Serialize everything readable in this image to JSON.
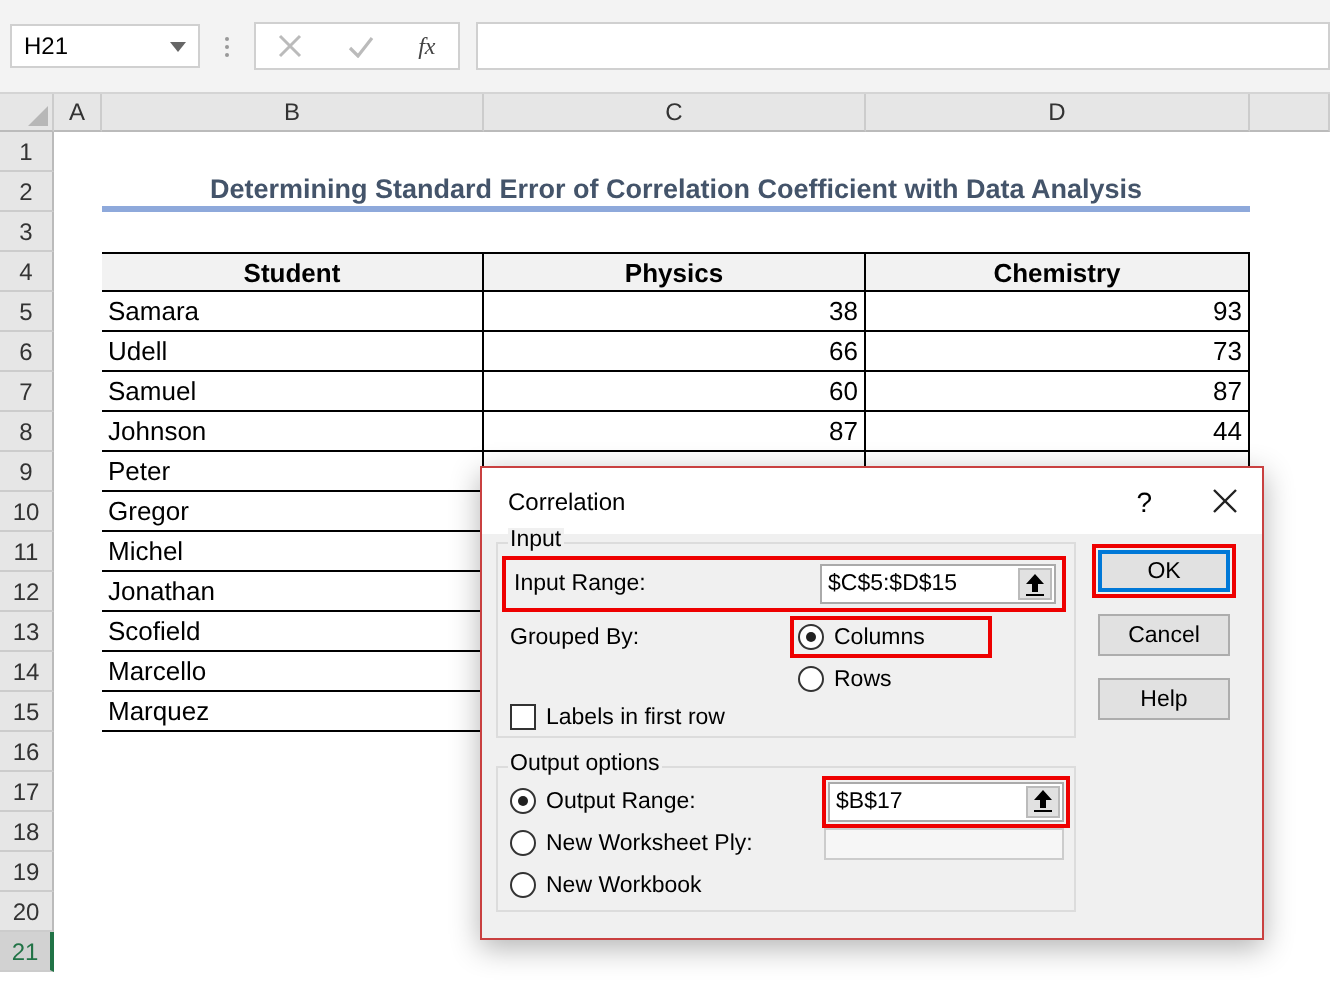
{
  "name_box": {
    "value": "H21"
  },
  "formula_bar": {
    "function_label": "fx"
  },
  "column_headers": [
    "A",
    "B",
    "C",
    "D"
  ],
  "row_headers": [
    {
      "label": "1",
      "selected": false
    },
    {
      "label": "2",
      "selected": false
    },
    {
      "label": "3",
      "selected": false
    },
    {
      "label": "4",
      "selected": false
    },
    {
      "label": "5",
      "selected": false
    },
    {
      "label": "6",
      "selected": false
    },
    {
      "label": "7",
      "selected": false
    },
    {
      "label": "8",
      "selected": false
    },
    {
      "label": "9",
      "selected": false
    },
    {
      "label": "10",
      "selected": false
    },
    {
      "label": "11",
      "selected": false
    },
    {
      "label": "12",
      "selected": false
    },
    {
      "label": "13",
      "selected": false
    },
    {
      "label": "14",
      "selected": false
    },
    {
      "label": "15",
      "selected": false
    },
    {
      "label": "16",
      "selected": false
    },
    {
      "label": "17",
      "selected": false
    },
    {
      "label": "18",
      "selected": false
    },
    {
      "label": "19",
      "selected": false
    },
    {
      "label": "20",
      "selected": false
    },
    {
      "label": "21",
      "selected": true
    }
  ],
  "title": "Determining Standard Error of Correlation Coefficient with Data Analysis",
  "table": {
    "columns": [
      "Student",
      "Physics",
      "Chemistry"
    ],
    "rows": [
      {
        "student": "Samara",
        "physics": "38",
        "chemistry": "93"
      },
      {
        "student": "Udell",
        "physics": "66",
        "chemistry": "73"
      },
      {
        "student": "Samuel",
        "physics": "60",
        "chemistry": "87"
      },
      {
        "student": "Johnson",
        "physics": "87",
        "chemistry": "44"
      },
      {
        "student": "Peter"
      },
      {
        "student": "Gregor"
      },
      {
        "student": "Michel"
      },
      {
        "student": "Jonathan"
      },
      {
        "student": "Scofield"
      },
      {
        "student": "Marcello"
      },
      {
        "student": "Marquez"
      }
    ]
  },
  "dialog": {
    "title": "Correlation",
    "help_mark": "?",
    "input_group": {
      "legend": "Input",
      "input_range": {
        "label": "Input Range:",
        "value": "$C$5:$D$15",
        "highlighted": true
      },
      "grouped_by_label": "Grouped By:",
      "grouped_by": [
        {
          "label": "Columns",
          "selected": true,
          "highlighted": true
        },
        {
          "label": "Rows",
          "selected": false,
          "highlighted": false
        }
      ],
      "labels_checkbox": {
        "label": "Labels in first row",
        "checked": false
      }
    },
    "output_group": {
      "legend": "Output options",
      "options": [
        {
          "kind": "range",
          "label": "Output Range:",
          "selected": true,
          "value": "$B$17",
          "highlighted": true
        },
        {
          "kind": "field",
          "label": "New Worksheet Ply:",
          "selected": false
        },
        {
          "kind": "plain",
          "label": "New Workbook",
          "selected": false
        }
      ]
    },
    "buttons": [
      {
        "label": "OK",
        "default": true,
        "highlighted": true
      },
      {
        "label": "Cancel",
        "default": false,
        "highlighted": false
      },
      {
        "label": "Help",
        "default": false,
        "highlighted": false
      }
    ]
  }
}
